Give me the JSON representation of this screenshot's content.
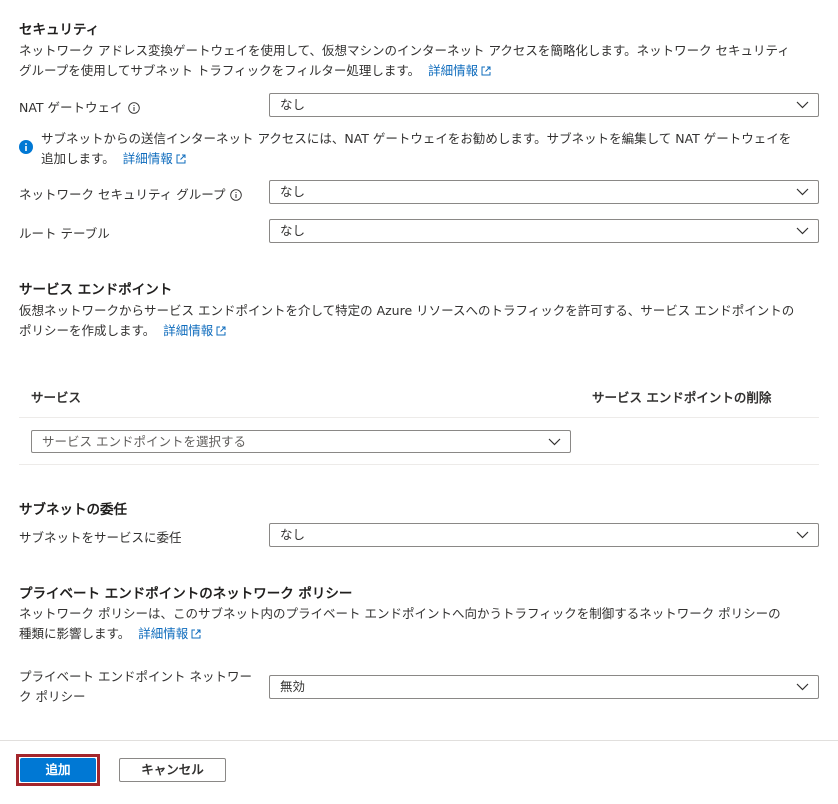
{
  "security": {
    "title": "セキュリティ",
    "desc_line1": "ネットワーク アドレス変換ゲートウェイを使用して、仮想マシンのインターネット アクセスを簡略化します。ネットワーク セキュリティ",
    "desc_line2": "グループを使用してサブネット トラフィックをフィルター処理します。",
    "learn_more": "詳細情報",
    "nat_label": "NAT ゲートウェイ",
    "nat_value": "なし",
    "info_line1": "サブネットからの送信インターネット アクセスには、NAT ゲートウェイをお勧めします。サブネットを編集して NAT ゲートウェイを",
    "info_line2": "追加します。",
    "info_learn_more": "詳細情報",
    "nsg_label": "ネットワーク セキュリティ グループ",
    "nsg_value": "なし",
    "route_label": "ルート テーブル",
    "route_value": "なし"
  },
  "service_endpoints": {
    "title": "サービス エンドポイント",
    "desc_line1": "仮想ネットワークからサービス エンドポイントを介して特定の Azure リソースへのトラフィックを許可する、サービス エンドポイントの",
    "desc_line2": "ポリシーを作成します。",
    "learn_more": "詳細情報",
    "col_service": "サービス",
    "col_delete": "サービス エンドポイントの削除",
    "select_placeholder": "サービス エンドポイントを選択する"
  },
  "delegation": {
    "title": "サブネットの委任",
    "label": "サブネットをサービスに委任",
    "value": "なし"
  },
  "private_endpoint": {
    "title": "プライベート エンドポイントのネットワーク ポリシー",
    "desc_line1": "ネットワーク ポリシーは、このサブネット内のプライベート エンドポイントへ向かうトラフィックを制御するネットワーク ポリシーの",
    "desc_line2": "種類に影響します。",
    "learn_more": "詳細情報",
    "label_line1": "プライベート エンドポイント ネットワー",
    "label_line2": "ク ポリシー",
    "value": "無効"
  },
  "footer": {
    "add_label": "追加",
    "cancel_label": "キャンセル"
  },
  "colors": {
    "accent": "#0078d4",
    "link": "#0f6cbd",
    "focus": "#a4262c"
  }
}
